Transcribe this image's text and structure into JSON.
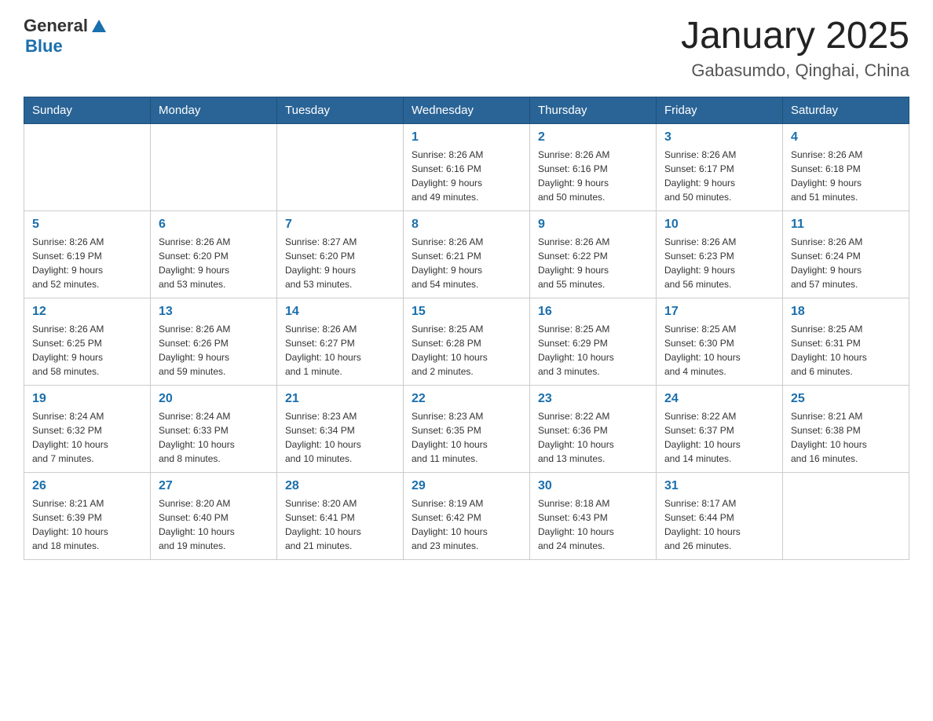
{
  "header": {
    "logo": {
      "general": "General",
      "blue": "Blue"
    },
    "title": "January 2025",
    "subtitle": "Gabasumdo, Qinghai, China"
  },
  "calendar": {
    "days_of_week": [
      "Sunday",
      "Monday",
      "Tuesday",
      "Wednesday",
      "Thursday",
      "Friday",
      "Saturday"
    ],
    "weeks": [
      [
        {
          "day": "",
          "info": ""
        },
        {
          "day": "",
          "info": ""
        },
        {
          "day": "",
          "info": ""
        },
        {
          "day": "1",
          "info": "Sunrise: 8:26 AM\nSunset: 6:16 PM\nDaylight: 9 hours\nand 49 minutes."
        },
        {
          "day": "2",
          "info": "Sunrise: 8:26 AM\nSunset: 6:16 PM\nDaylight: 9 hours\nand 50 minutes."
        },
        {
          "day": "3",
          "info": "Sunrise: 8:26 AM\nSunset: 6:17 PM\nDaylight: 9 hours\nand 50 minutes."
        },
        {
          "day": "4",
          "info": "Sunrise: 8:26 AM\nSunset: 6:18 PM\nDaylight: 9 hours\nand 51 minutes."
        }
      ],
      [
        {
          "day": "5",
          "info": "Sunrise: 8:26 AM\nSunset: 6:19 PM\nDaylight: 9 hours\nand 52 minutes."
        },
        {
          "day": "6",
          "info": "Sunrise: 8:26 AM\nSunset: 6:20 PM\nDaylight: 9 hours\nand 53 minutes."
        },
        {
          "day": "7",
          "info": "Sunrise: 8:27 AM\nSunset: 6:20 PM\nDaylight: 9 hours\nand 53 minutes."
        },
        {
          "day": "8",
          "info": "Sunrise: 8:26 AM\nSunset: 6:21 PM\nDaylight: 9 hours\nand 54 minutes."
        },
        {
          "day": "9",
          "info": "Sunrise: 8:26 AM\nSunset: 6:22 PM\nDaylight: 9 hours\nand 55 minutes."
        },
        {
          "day": "10",
          "info": "Sunrise: 8:26 AM\nSunset: 6:23 PM\nDaylight: 9 hours\nand 56 minutes."
        },
        {
          "day": "11",
          "info": "Sunrise: 8:26 AM\nSunset: 6:24 PM\nDaylight: 9 hours\nand 57 minutes."
        }
      ],
      [
        {
          "day": "12",
          "info": "Sunrise: 8:26 AM\nSunset: 6:25 PM\nDaylight: 9 hours\nand 58 minutes."
        },
        {
          "day": "13",
          "info": "Sunrise: 8:26 AM\nSunset: 6:26 PM\nDaylight: 9 hours\nand 59 minutes."
        },
        {
          "day": "14",
          "info": "Sunrise: 8:26 AM\nSunset: 6:27 PM\nDaylight: 10 hours\nand 1 minute."
        },
        {
          "day": "15",
          "info": "Sunrise: 8:25 AM\nSunset: 6:28 PM\nDaylight: 10 hours\nand 2 minutes."
        },
        {
          "day": "16",
          "info": "Sunrise: 8:25 AM\nSunset: 6:29 PM\nDaylight: 10 hours\nand 3 minutes."
        },
        {
          "day": "17",
          "info": "Sunrise: 8:25 AM\nSunset: 6:30 PM\nDaylight: 10 hours\nand 4 minutes."
        },
        {
          "day": "18",
          "info": "Sunrise: 8:25 AM\nSunset: 6:31 PM\nDaylight: 10 hours\nand 6 minutes."
        }
      ],
      [
        {
          "day": "19",
          "info": "Sunrise: 8:24 AM\nSunset: 6:32 PM\nDaylight: 10 hours\nand 7 minutes."
        },
        {
          "day": "20",
          "info": "Sunrise: 8:24 AM\nSunset: 6:33 PM\nDaylight: 10 hours\nand 8 minutes."
        },
        {
          "day": "21",
          "info": "Sunrise: 8:23 AM\nSunset: 6:34 PM\nDaylight: 10 hours\nand 10 minutes."
        },
        {
          "day": "22",
          "info": "Sunrise: 8:23 AM\nSunset: 6:35 PM\nDaylight: 10 hours\nand 11 minutes."
        },
        {
          "day": "23",
          "info": "Sunrise: 8:22 AM\nSunset: 6:36 PM\nDaylight: 10 hours\nand 13 minutes."
        },
        {
          "day": "24",
          "info": "Sunrise: 8:22 AM\nSunset: 6:37 PM\nDaylight: 10 hours\nand 14 minutes."
        },
        {
          "day": "25",
          "info": "Sunrise: 8:21 AM\nSunset: 6:38 PM\nDaylight: 10 hours\nand 16 minutes."
        }
      ],
      [
        {
          "day": "26",
          "info": "Sunrise: 8:21 AM\nSunset: 6:39 PM\nDaylight: 10 hours\nand 18 minutes."
        },
        {
          "day": "27",
          "info": "Sunrise: 8:20 AM\nSunset: 6:40 PM\nDaylight: 10 hours\nand 19 minutes."
        },
        {
          "day": "28",
          "info": "Sunrise: 8:20 AM\nSunset: 6:41 PM\nDaylight: 10 hours\nand 21 minutes."
        },
        {
          "day": "29",
          "info": "Sunrise: 8:19 AM\nSunset: 6:42 PM\nDaylight: 10 hours\nand 23 minutes."
        },
        {
          "day": "30",
          "info": "Sunrise: 8:18 AM\nSunset: 6:43 PM\nDaylight: 10 hours\nand 24 minutes."
        },
        {
          "day": "31",
          "info": "Sunrise: 8:17 AM\nSunset: 6:44 PM\nDaylight: 10 hours\nand 26 minutes."
        },
        {
          "day": "",
          "info": ""
        }
      ]
    ]
  }
}
